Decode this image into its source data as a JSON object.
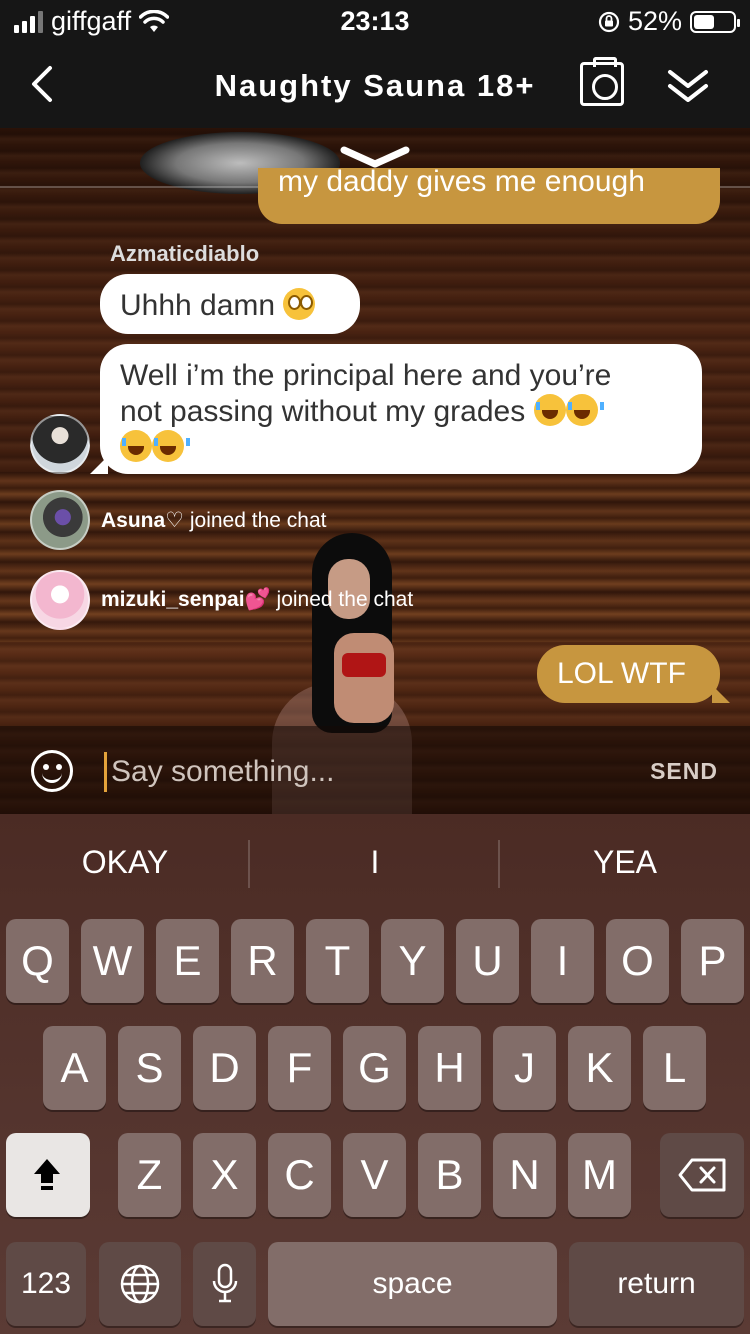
{
  "status_bar": {
    "carrier": "giffgaff",
    "time": "23:13",
    "battery_percent": "52%",
    "battery_level": 0.52
  },
  "nav": {
    "back_icon": "chevron-left-icon",
    "title": "Naughty Sauna 18+",
    "camera_icon": "camera-icon",
    "collapse_icon": "double-chevron-down-icon"
  },
  "chat": {
    "partial_message": "my daddy gives me enough",
    "sender_name": "Azmaticdiablo",
    "message_1": "Uhhh damn",
    "message_2_line1": "Well i’m the principal here and you’re",
    "message_2_line2": "not passing without my grades",
    "join_1_user": "Asuna♡",
    "join_1_text": "joined the chat",
    "join_2_user": "mizuki_senpai💕",
    "join_2_text": "joined the chat",
    "my_message": "LOL WTF"
  },
  "input": {
    "placeholder": "Say something...",
    "send_label": "SEND"
  },
  "keyboard": {
    "suggestions": [
      "OKAY",
      "I",
      "YEA"
    ],
    "row1": [
      "Q",
      "W",
      "E",
      "R",
      "T",
      "Y",
      "U",
      "I",
      "O",
      "P"
    ],
    "row2": [
      "A",
      "S",
      "D",
      "F",
      "G",
      "H",
      "J",
      "K",
      "L"
    ],
    "row3": [
      "Z",
      "X",
      "C",
      "V",
      "B",
      "N",
      "M"
    ],
    "numbers_label": "123",
    "space_label": "space",
    "return_label": "return"
  },
  "colors": {
    "accent": "#c7963f",
    "cursor": "#e4a33b",
    "bubble_in": "#ffffff"
  }
}
